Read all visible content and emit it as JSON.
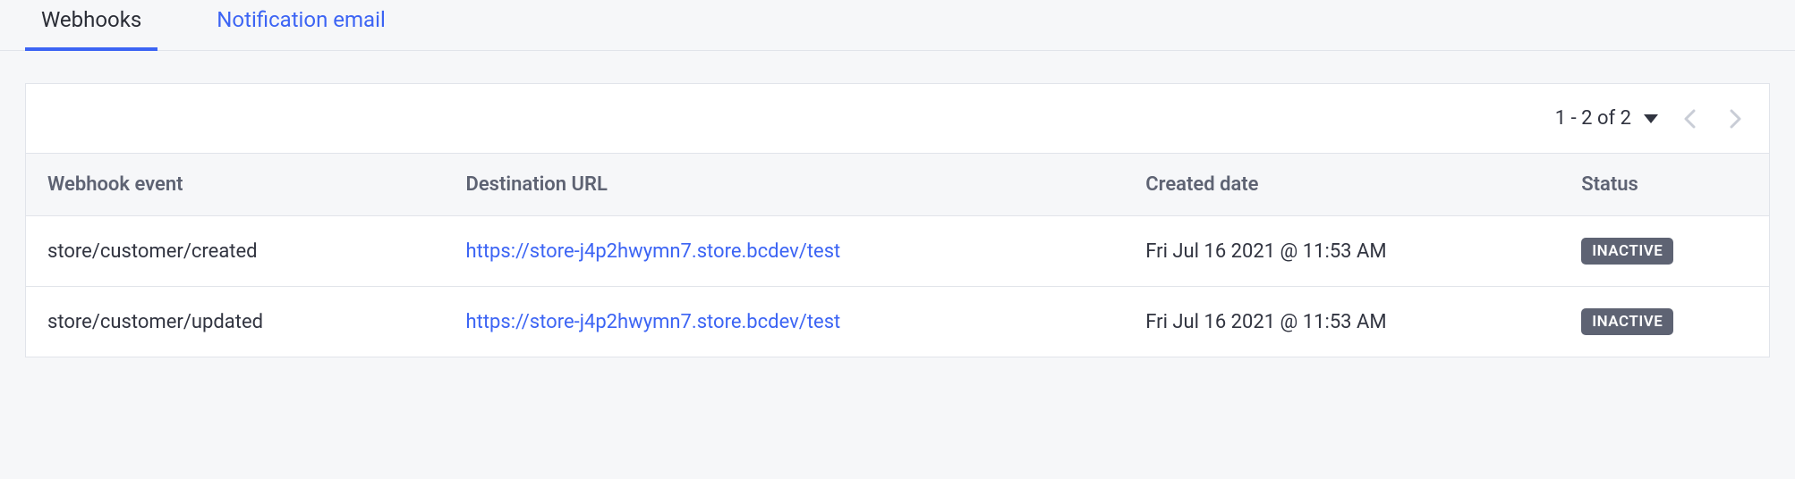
{
  "tabs": [
    {
      "label": "Webhooks",
      "active": true
    },
    {
      "label": "Notification email",
      "active": false
    }
  ],
  "pagination": {
    "text": "1 - 2 of 2"
  },
  "table": {
    "headers": {
      "event": "Webhook event",
      "destination": "Destination URL",
      "created": "Created date",
      "status": "Status"
    },
    "rows": [
      {
        "event": "store/customer/created",
        "destination": "https://store-j4p2hwymn7.store.bcdev/test",
        "created": "Fri Jul 16 2021 @ 11:53 AM",
        "status": "INACTIVE"
      },
      {
        "event": "store/customer/updated",
        "destination": "https://store-j4p2hwymn7.store.bcdev/test",
        "created": "Fri Jul 16 2021 @ 11:53 AM",
        "status": "INACTIVE"
      }
    ]
  }
}
